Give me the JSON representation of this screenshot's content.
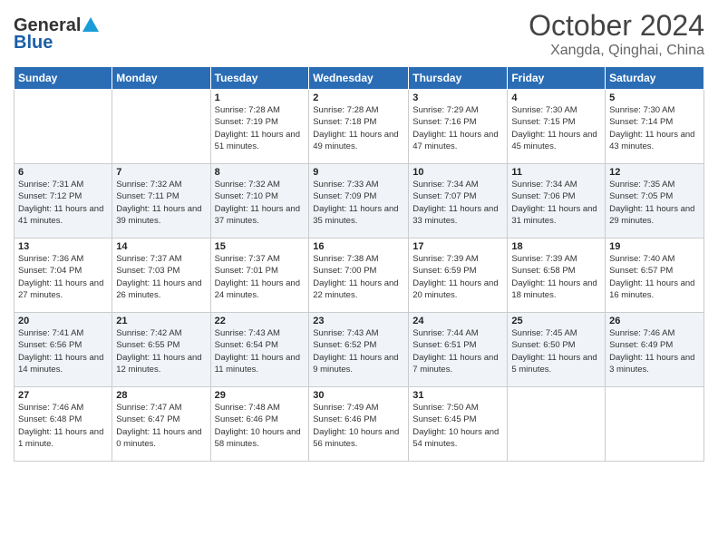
{
  "header": {
    "logo_general": "General",
    "logo_blue": "Blue",
    "month_title": "October 2024",
    "location": "Xangda, Qinghai, China"
  },
  "weekdays": [
    "Sunday",
    "Monday",
    "Tuesday",
    "Wednesday",
    "Thursday",
    "Friday",
    "Saturday"
  ],
  "weeks": [
    [
      {
        "day": "",
        "info": ""
      },
      {
        "day": "",
        "info": ""
      },
      {
        "day": "1",
        "info": "Sunrise: 7:28 AM\nSunset: 7:19 PM\nDaylight: 11 hours and 51 minutes."
      },
      {
        "day": "2",
        "info": "Sunrise: 7:28 AM\nSunset: 7:18 PM\nDaylight: 11 hours and 49 minutes."
      },
      {
        "day": "3",
        "info": "Sunrise: 7:29 AM\nSunset: 7:16 PM\nDaylight: 11 hours and 47 minutes."
      },
      {
        "day": "4",
        "info": "Sunrise: 7:30 AM\nSunset: 7:15 PM\nDaylight: 11 hours and 45 minutes."
      },
      {
        "day": "5",
        "info": "Sunrise: 7:30 AM\nSunset: 7:14 PM\nDaylight: 11 hours and 43 minutes."
      }
    ],
    [
      {
        "day": "6",
        "info": "Sunrise: 7:31 AM\nSunset: 7:12 PM\nDaylight: 11 hours and 41 minutes."
      },
      {
        "day": "7",
        "info": "Sunrise: 7:32 AM\nSunset: 7:11 PM\nDaylight: 11 hours and 39 minutes."
      },
      {
        "day": "8",
        "info": "Sunrise: 7:32 AM\nSunset: 7:10 PM\nDaylight: 11 hours and 37 minutes."
      },
      {
        "day": "9",
        "info": "Sunrise: 7:33 AM\nSunset: 7:09 PM\nDaylight: 11 hours and 35 minutes."
      },
      {
        "day": "10",
        "info": "Sunrise: 7:34 AM\nSunset: 7:07 PM\nDaylight: 11 hours and 33 minutes."
      },
      {
        "day": "11",
        "info": "Sunrise: 7:34 AM\nSunset: 7:06 PM\nDaylight: 11 hours and 31 minutes."
      },
      {
        "day": "12",
        "info": "Sunrise: 7:35 AM\nSunset: 7:05 PM\nDaylight: 11 hours and 29 minutes."
      }
    ],
    [
      {
        "day": "13",
        "info": "Sunrise: 7:36 AM\nSunset: 7:04 PM\nDaylight: 11 hours and 27 minutes."
      },
      {
        "day": "14",
        "info": "Sunrise: 7:37 AM\nSunset: 7:03 PM\nDaylight: 11 hours and 26 minutes."
      },
      {
        "day": "15",
        "info": "Sunrise: 7:37 AM\nSunset: 7:01 PM\nDaylight: 11 hours and 24 minutes."
      },
      {
        "day": "16",
        "info": "Sunrise: 7:38 AM\nSunset: 7:00 PM\nDaylight: 11 hours and 22 minutes."
      },
      {
        "day": "17",
        "info": "Sunrise: 7:39 AM\nSunset: 6:59 PM\nDaylight: 11 hours and 20 minutes."
      },
      {
        "day": "18",
        "info": "Sunrise: 7:39 AM\nSunset: 6:58 PM\nDaylight: 11 hours and 18 minutes."
      },
      {
        "day": "19",
        "info": "Sunrise: 7:40 AM\nSunset: 6:57 PM\nDaylight: 11 hours and 16 minutes."
      }
    ],
    [
      {
        "day": "20",
        "info": "Sunrise: 7:41 AM\nSunset: 6:56 PM\nDaylight: 11 hours and 14 minutes."
      },
      {
        "day": "21",
        "info": "Sunrise: 7:42 AM\nSunset: 6:55 PM\nDaylight: 11 hours and 12 minutes."
      },
      {
        "day": "22",
        "info": "Sunrise: 7:43 AM\nSunset: 6:54 PM\nDaylight: 11 hours and 11 minutes."
      },
      {
        "day": "23",
        "info": "Sunrise: 7:43 AM\nSunset: 6:52 PM\nDaylight: 11 hours and 9 minutes."
      },
      {
        "day": "24",
        "info": "Sunrise: 7:44 AM\nSunset: 6:51 PM\nDaylight: 11 hours and 7 minutes."
      },
      {
        "day": "25",
        "info": "Sunrise: 7:45 AM\nSunset: 6:50 PM\nDaylight: 11 hours and 5 minutes."
      },
      {
        "day": "26",
        "info": "Sunrise: 7:46 AM\nSunset: 6:49 PM\nDaylight: 11 hours and 3 minutes."
      }
    ],
    [
      {
        "day": "27",
        "info": "Sunrise: 7:46 AM\nSunset: 6:48 PM\nDaylight: 11 hours and 1 minute."
      },
      {
        "day": "28",
        "info": "Sunrise: 7:47 AM\nSunset: 6:47 PM\nDaylight: 11 hours and 0 minutes."
      },
      {
        "day": "29",
        "info": "Sunrise: 7:48 AM\nSunset: 6:46 PM\nDaylight: 10 hours and 58 minutes."
      },
      {
        "day": "30",
        "info": "Sunrise: 7:49 AM\nSunset: 6:46 PM\nDaylight: 10 hours and 56 minutes."
      },
      {
        "day": "31",
        "info": "Sunrise: 7:50 AM\nSunset: 6:45 PM\nDaylight: 10 hours and 54 minutes."
      },
      {
        "day": "",
        "info": ""
      },
      {
        "day": "",
        "info": ""
      }
    ]
  ]
}
